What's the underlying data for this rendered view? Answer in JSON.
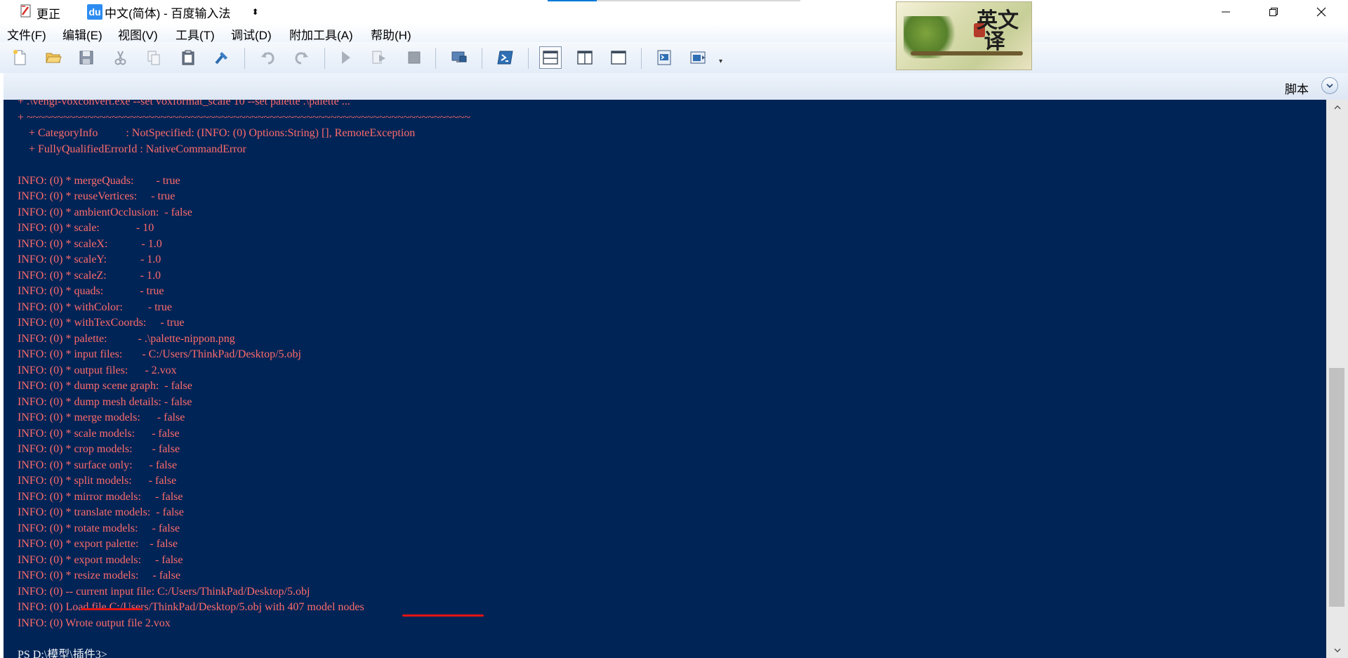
{
  "window": {
    "title": "更正",
    "ime": {
      "logo": "du",
      "label": "中文(简体) - 百度输入法",
      "arrow": "⬍"
    },
    "controls": [
      "minimize-icon",
      "restore-icon",
      "close-icon"
    ]
  },
  "menu": [
    "文件(F)",
    "编辑(E)",
    "视图(V)",
    "工具(T)",
    "调试(D)",
    "附加工具(A)",
    "帮助(H)"
  ],
  "toolbar_icons": [
    "new-file-icon",
    "open-folder-icon",
    "save-icon",
    "cut-icon",
    "copy-icon",
    "paste-icon",
    "clear-icon",
    "undo-icon",
    "redo-icon",
    "run-icon",
    "run-selection-icon",
    "stop-icon",
    "remote-session-icon",
    "powershell-icon",
    "layout-top-icon",
    "layout-right-icon",
    "layout-max-icon",
    "show-script-icon",
    "show-console-icon"
  ],
  "logo": {
    "text": "英文\n译"
  },
  "script_pane": {
    "label": "脚本"
  },
  "console": {
    "lines": [
      {
        "text": "+ .\\vengi-voxconvert.exe --set voxformat_scale 10 --set palette .\\palette ...",
        "type": "err"
      },
      {
        "text": "+ ~~~~~~~~~~~~~~~~~~~~~~~~~~~~~~~~~~~~~~~~~~~~~~~~~~~~~~~~~~~~~~~~~~~~~~~~~",
        "type": "err"
      },
      {
        "text": "    + CategoryInfo          : NotSpecified: (INFO: (0) Options:String) [], RemoteException",
        "type": "err"
      },
      {
        "text": "    + FullyQualifiedErrorId : NativeCommandError",
        "type": "err"
      },
      {
        "text": "",
        "type": "info"
      },
      {
        "text": "INFO: (0) * mergeQuads:        - true",
        "type": "err"
      },
      {
        "text": "INFO: (0) * reuseVertices:     - true",
        "type": "err"
      },
      {
        "text": "INFO: (0) * ambientOcclusion:  - false",
        "type": "err"
      },
      {
        "text": "INFO: (0) * scale:             - 10",
        "type": "err"
      },
      {
        "text": "INFO: (0) * scaleX:            - 1.0",
        "type": "err"
      },
      {
        "text": "INFO: (0) * scaleY:            - 1.0",
        "type": "err"
      },
      {
        "text": "INFO: (0) * scaleZ:            - 1.0",
        "type": "err"
      },
      {
        "text": "INFO: (0) * quads:             - true",
        "type": "err"
      },
      {
        "text": "INFO: (0) * withColor:         - true",
        "type": "err"
      },
      {
        "text": "INFO: (0) * withTexCoords:     - true",
        "type": "err"
      },
      {
        "text": "INFO: (0) * palette:           - .\\palette-nippon.png",
        "type": "err"
      },
      {
        "text": "INFO: (0) * input files:       - C:/Users/ThinkPad/Desktop/5.obj",
        "type": "err"
      },
      {
        "text": "INFO: (0) * output files:      - 2.vox",
        "type": "err"
      },
      {
        "text": "INFO: (0) * dump scene graph:  - false",
        "type": "err"
      },
      {
        "text": "INFO: (0) * dump mesh details: - false",
        "type": "err"
      },
      {
        "text": "INFO: (0) * merge models:      - false",
        "type": "err"
      },
      {
        "text": "INFO: (0) * scale models:      - false",
        "type": "err"
      },
      {
        "text": "INFO: (0) * crop models:       - false",
        "type": "err"
      },
      {
        "text": "INFO: (0) * surface only:      - false",
        "type": "err"
      },
      {
        "text": "INFO: (0) * split models:      - false",
        "type": "err"
      },
      {
        "text": "INFO: (0) * mirror models:     - false",
        "type": "err"
      },
      {
        "text": "INFO: (0) * translate models:  - false",
        "type": "err"
      },
      {
        "text": "INFO: (0) * rotate models:     - false",
        "type": "err"
      },
      {
        "text": "INFO: (0) * export palette:    - false",
        "type": "err"
      },
      {
        "text": "INFO: (0) * export models:     - false",
        "type": "err"
      },
      {
        "text": "INFO: (0) * resize models:     - false",
        "type": "err"
      },
      {
        "text": "INFO: (0) -- current input file: C:/Users/ThinkPad/Desktop/5.obj",
        "type": "err"
      },
      {
        "text": "INFO: (0) Load file C:/Users/ThinkPad/Desktop/5.obj with 407 model nodes",
        "type": "err"
      },
      {
        "text": "INFO: (0) Wrote output file 2.vox",
        "type": "err"
      },
      {
        "text": "",
        "type": "info"
      },
      {
        "text": "PS D:\\模型\\插件3>",
        "type": "info"
      }
    ]
  },
  "colors": {
    "console_bg": "#012456",
    "error_text": "#ff6b6b",
    "info_text": "#f1f3f7",
    "underline": "#e31414"
  }
}
